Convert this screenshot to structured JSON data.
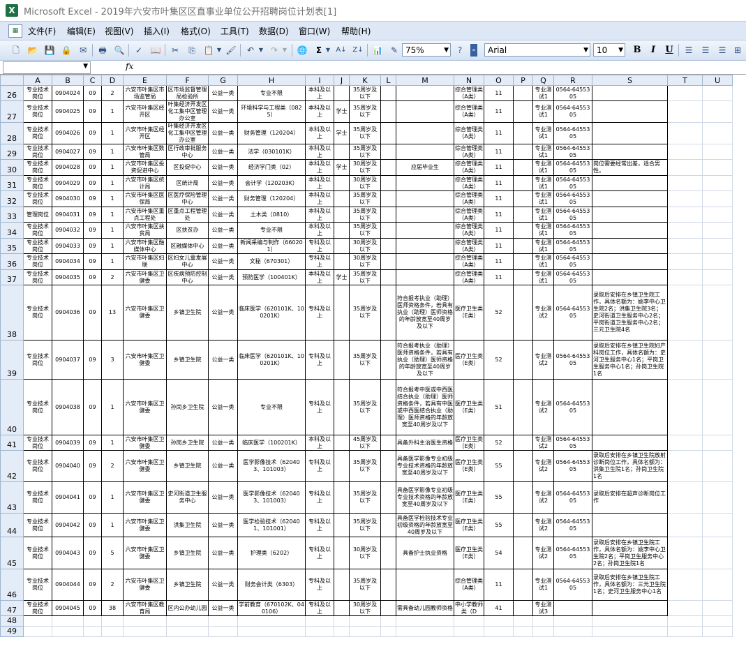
{
  "window": {
    "title": "Microsoft Excel - 2019年六安市叶集区区直事业单位公开招聘岗位计划表[1]",
    "app_icon": "X"
  },
  "menu": [
    "文件(F)",
    "编辑(E)",
    "视图(V)",
    "插入(I)",
    "格式(O)",
    "工具(T)",
    "数据(D)",
    "窗口(W)",
    "帮助(H)"
  ],
  "toolbar": {
    "zoom": "75%",
    "font_name": "Arial",
    "font_size": "10",
    "bold": "B",
    "italic": "I",
    "underline": "U",
    "sigma": "Σ",
    "fx": "fx"
  },
  "columns": [
    "A",
    "B",
    "C",
    "D",
    "E",
    "F",
    "G",
    "H",
    "I",
    "J",
    "K",
    "L",
    "M",
    "N",
    "O",
    "P",
    "Q",
    "R",
    "S",
    "T",
    "U"
  ],
  "rows": [
    {
      "n": "26",
      "h": 22,
      "c": [
        "专业技术岗位",
        "0904024",
        "09",
        "2",
        "六安市叶集区市场监管局",
        "区市场监督管理局检验所",
        "公益一类",
        "专业不限",
        "本科及以上",
        "",
        "35周岁及以下",
        "",
        "",
        "综合管理类（A类）",
        "11",
        "",
        "专业测试1",
        "0564-6455305",
        "",
        ""
      ]
    },
    {
      "n": "27",
      "h": 23,
      "c": [
        "专业技术岗位",
        "0904025",
        "09",
        "1",
        "六安市叶集区经开区",
        "叶集经济开发区化工集中区管理办公室",
        "公益一类",
        "环境科学与工程类（0825）",
        "本科及以上",
        "学士",
        "35周岁及以下",
        "",
        "",
        "综合管理类（A类）",
        "11",
        "",
        "专业测试1",
        "0564-6455305",
        "",
        ""
      ]
    },
    {
      "n": "28",
      "h": 23,
      "c": [
        "专业技术岗位",
        "0904026",
        "09",
        "1",
        "六安市叶集区经开区",
        "叶集经济开发区化工集中区管理办公室",
        "公益一类",
        "财务管理（120204）",
        "本科及以上",
        "学士",
        "35周岁及以下",
        "",
        "",
        "综合管理类（A类）",
        "11",
        "",
        "专业测试1",
        "0564-6455305",
        "",
        ""
      ]
    },
    {
      "n": "29",
      "h": 22,
      "c": [
        "专业技术岗位",
        "0904027",
        "09",
        "1",
        "六安市叶集区数管局",
        "区行政审批服务中心",
        "公益一类",
        "法学（030101K）",
        "本科及以上",
        "",
        "35周岁及以下",
        "",
        "",
        "综合管理类（A类）",
        "11",
        "",
        "专业测试1",
        "0564-6455305",
        "",
        ""
      ]
    },
    {
      "n": "30",
      "h": 23,
      "c": [
        "专业技术岗位",
        "0904028",
        "09",
        "1",
        "六安市叶集区投资促进中心",
        "区投促中心",
        "公益一类",
        "经济学门类（02）",
        "本科及以上",
        "学士",
        "30周岁及以下",
        "",
        "应届毕业生",
        "综合管理类（A类）",
        "11",
        "",
        "专业测试1",
        "0564-6455305",
        "岗位需要经常出差，适合男性。",
        ""
      ]
    },
    {
      "n": "31",
      "h": 22,
      "c": [
        "专业技术岗位",
        "0904029",
        "09",
        "1",
        "六安市叶集区统计局",
        "区统计局",
        "公益一类",
        "会计学（120203K）",
        "本科及以上",
        "",
        "30周岁及以下",
        "",
        "",
        "综合管理类（A类）",
        "11",
        "",
        "专业测试1",
        "0564-6455305",
        "",
        ""
      ]
    },
    {
      "n": "32",
      "h": 23,
      "c": [
        "专业技术岗位",
        "0904030",
        "09",
        "1",
        "六安市叶集区医保局",
        "区医疗保险管理中心",
        "公益一类",
        "财务管理（120204）",
        "本科及以上",
        "",
        "35周岁及以下",
        "",
        "",
        "综合管理类（A类）",
        "11",
        "",
        "专业测试1",
        "0564-6455305",
        "",
        ""
      ]
    },
    {
      "n": "33",
      "h": 22,
      "c": [
        "管理岗位",
        "0904031",
        "09",
        "1",
        "六安市叶集区重点工程处",
        "区重点工程管理处",
        "公益一类",
        "土木类（0810）",
        "本科及以上",
        "",
        "35周岁及以下",
        "",
        "",
        "综合管理类（A类）",
        "11",
        "",
        "专业测试1",
        "0564-6455305",
        "",
        ""
      ]
    },
    {
      "n": "34",
      "h": 23,
      "c": [
        "专业技术岗位",
        "0904032",
        "09",
        "1",
        "六安市叶集区扶贫局",
        "区扶贫办",
        "公益一类",
        "专业不限",
        "本科及以上",
        "",
        "35周岁及以下",
        "",
        "",
        "综合管理类（A类）",
        "11",
        "",
        "专业测试1",
        "0564-6455305",
        "",
        ""
      ]
    },
    {
      "n": "35",
      "h": 22,
      "c": [
        "专业技术岗位",
        "0904033",
        "09",
        "1",
        "六安市叶集区融媒体中心",
        "区融媒体中心",
        "公益一类",
        "新闻采编与制作（660201）",
        "专科及以上",
        "",
        "30周岁及以下",
        "",
        "",
        "综合管理类（A类）",
        "11",
        "",
        "专业测试1",
        "0564-6455305",
        "",
        ""
      ]
    },
    {
      "n": "36",
      "h": 23,
      "c": [
        "专业技术岗位",
        "0904034",
        "09",
        "1",
        "六安市叶集区妇联",
        "区妇女儿童发展中心",
        "公益一类",
        "文秘（670301）",
        "专科及以上",
        "",
        "30周岁及以下",
        "",
        "",
        "综合管理类（A类）",
        "11",
        "",
        "专业测试1",
        "0564-6455305",
        "",
        ""
      ]
    },
    {
      "n": "37",
      "h": 22,
      "c": [
        "专业技术岗位",
        "0904035",
        "09",
        "2",
        "六安市叶集区卫健委",
        "区疾病预防控制中心",
        "公益一类",
        "预防医学（100401K）",
        "本科及以上",
        "学士",
        "35周岁及以下",
        "",
        "",
        "综合管理类（A类）",
        "11",
        "",
        "专业测试1",
        "0564-6455305",
        "",
        ""
      ]
    },
    {
      "n": "38",
      "h": 79,
      "c": [
        "专业技术岗位",
        "0904036",
        "09",
        "13",
        "六安市叶集区卫健委",
        "乡镇卫生院",
        "公益一类",
        "临床医学（620101K、100201K）",
        "专科及以上",
        "",
        "35周岁及以下",
        "",
        "符合报考执业（助理）医师资格条件，若具有执业（助理）医师资格的年龄放宽至40周岁及以下",
        "医疗卫生类（E类）",
        "52",
        "",
        "专业测试2",
        "0564-6455305",
        "录取后安排在乡镇卫生院工作，具体名额为：姚李中心卫生院2名；洪集卫生院3名；史河街道卫生服务中心2名；平岗街道卫生服务中心2名；三元卫生院4名",
        ""
      ]
    },
    {
      "n": "39",
      "h": 56,
      "c": [
        "专业技术岗位",
        "0904037",
        "09",
        "3",
        "六安市叶集区卫健委",
        "乡镇卫生院",
        "公益一类",
        "临床医学（620101K、100201K）",
        "专科及以上",
        "",
        "35周岁及以下",
        "",
        "符合报考执业（助理）医师资格条件，若具有执业（助理）医师资格的年龄放宽至40周岁及以下",
        "医疗卫生类（E类）",
        "52",
        "",
        "专业测试2",
        "0564-6455305",
        "录取后安排在乡镇卫生院妇产科岗位工作，具体名额为：史河卫生服务中心1名；平岗卫生服务中心1名；孙岗卫生院1名",
        ""
      ]
    },
    {
      "n": "40",
      "h": 80,
      "c": [
        "专业技术岗位",
        "0904038",
        "09",
        "1",
        "六安市叶集区卫健委",
        "孙岗乡卫生院",
        "公益一类",
        "专业不限",
        "专科及以上",
        "",
        "35周岁及以下",
        "",
        "符合报考中医或中西医结合执业（助理）医师资格条件，若具有中医或中西医结合执业（助理）医师资格的年龄放宽至40周岁及以下",
        "医疗卫生类（E类）",
        "51",
        "",
        "专业测试2",
        "0564-6455305",
        "",
        ""
      ]
    },
    {
      "n": "41",
      "h": 22,
      "c": [
        "专业技术岗位",
        "0904039",
        "09",
        "1",
        "六安市叶集区卫健委",
        "孙岗乡卫生院",
        "公益一类",
        "临床医学（100201K）",
        "本科及以上",
        "",
        "45周岁及以下",
        "",
        "具备外科主治医生资格",
        "医疗卫生类（E类）",
        "52",
        "",
        "专业测试2",
        "0564-6455305",
        "",
        ""
      ]
    },
    {
      "n": "42",
      "h": 45,
      "c": [
        "专业技术岗位",
        "0904040",
        "09",
        "2",
        "六安市叶集区卫健委",
        "乡镇卫生院",
        "公益一类",
        "医学影像技术（620403、101003）",
        "专科及以上",
        "",
        "35周岁及以下",
        "",
        "具备医学影像专业初级专业技术资格的年龄放宽至40周岁及以下",
        "医疗卫生类（E类）",
        "55",
        "",
        "专业测试2",
        "0564-6455305",
        "录取后安排在乡镇卫生院放射诊断岗位工作，具体名额为：洪集卫生院1名；孙岗卫生院1名",
        ""
      ]
    },
    {
      "n": "43",
      "h": 45,
      "c": [
        "专业技术岗位",
        "0904041",
        "09",
        "1",
        "六安市叶集区卫健委",
        "史河街道卫生服务中心",
        "公益一类",
        "医学影像技术（620403、101003）",
        "专科及以上",
        "",
        "35周岁及以下",
        "",
        "具备医学影像专业初级专业技术资格的年龄放宽至40周岁及以下",
        "医疗卫生类（E类）",
        "55",
        "",
        "专业测试2",
        "0564-6455305",
        "录取后安排在超声诊断岗位工作",
        ""
      ]
    },
    {
      "n": "44",
      "h": 34,
      "c": [
        "专业技术岗位",
        "0904042",
        "09",
        "1",
        "六安市叶集区卫健委",
        "洪集卫生院",
        "公益一类",
        "医学检验技术（620401、101001）",
        "专科及以上",
        "",
        "35周岁及以下",
        "",
        "具备医学检验技术专业初级资格的年龄放宽至40周岁及以下",
        "医疗卫生类（E类）",
        "55",
        "",
        "专业测试2",
        "0564-6455305",
        "",
        ""
      ]
    },
    {
      "n": "45",
      "h": 46,
      "c": [
        "专业技术岗位",
        "0904043",
        "09",
        "5",
        "六安市叶集区卫健委",
        "乡镇卫生院",
        "公益一类",
        "护理类（6202）",
        "专科及以上",
        "",
        "30周岁及以下",
        "",
        "具备护士执业资格",
        "医疗卫生类（E类）",
        "54",
        "",
        "专业测试2",
        "0564-6455305",
        "录取后安排在乡镇卫生院工作，具体名额为：姚李中心卫生院2名；平岗卫生服务中心2名；孙岗卫生院1名",
        ""
      ]
    },
    {
      "n": "46",
      "h": 45,
      "c": [
        "专业技术岗位",
        "0904044",
        "09",
        "2",
        "六安市叶集区卫健委",
        "乡镇卫生院",
        "公益一类",
        "财务会计类（6303）",
        "专科及以上",
        "",
        "35周岁及以下",
        "",
        "",
        "综合管理类（A类）",
        "11",
        "",
        "专业测试1",
        "0564-6455305",
        "录取后安排在乡镇卫生院工作，具体名额为：三元卫生院1名；史河卫生服务中心1名",
        ""
      ]
    },
    {
      "n": "47",
      "h": 22,
      "c": [
        "专业技术岗位",
        "0904045",
        "09",
        "38",
        "六安市叶集区教育局",
        "区内公办幼儿园",
        "公益一类",
        "学前教育（670102K、040106）",
        "专科及以上",
        "",
        "30周岁及以下",
        "",
        "需具备幼儿园教师资格",
        "中小学教师类（D",
        "41",
        "",
        "专业测试3",
        "",
        "",
        ""
      ]
    },
    {
      "n": "48",
      "h": 11,
      "c": [
        "",
        "",
        "",
        "",
        "",
        "",
        "",
        "",
        "",
        "",
        "",
        "",
        "",
        "",
        "",
        "",
        "",
        "",
        "",
        ""
      ]
    },
    {
      "n": "49",
      "h": 11,
      "c": [
        "",
        "",
        "",
        "",
        "",
        "",
        "",
        "",
        "",
        "",
        "",
        "",
        "",
        "",
        "",
        "",
        "",
        "",
        "",
        ""
      ]
    }
  ]
}
